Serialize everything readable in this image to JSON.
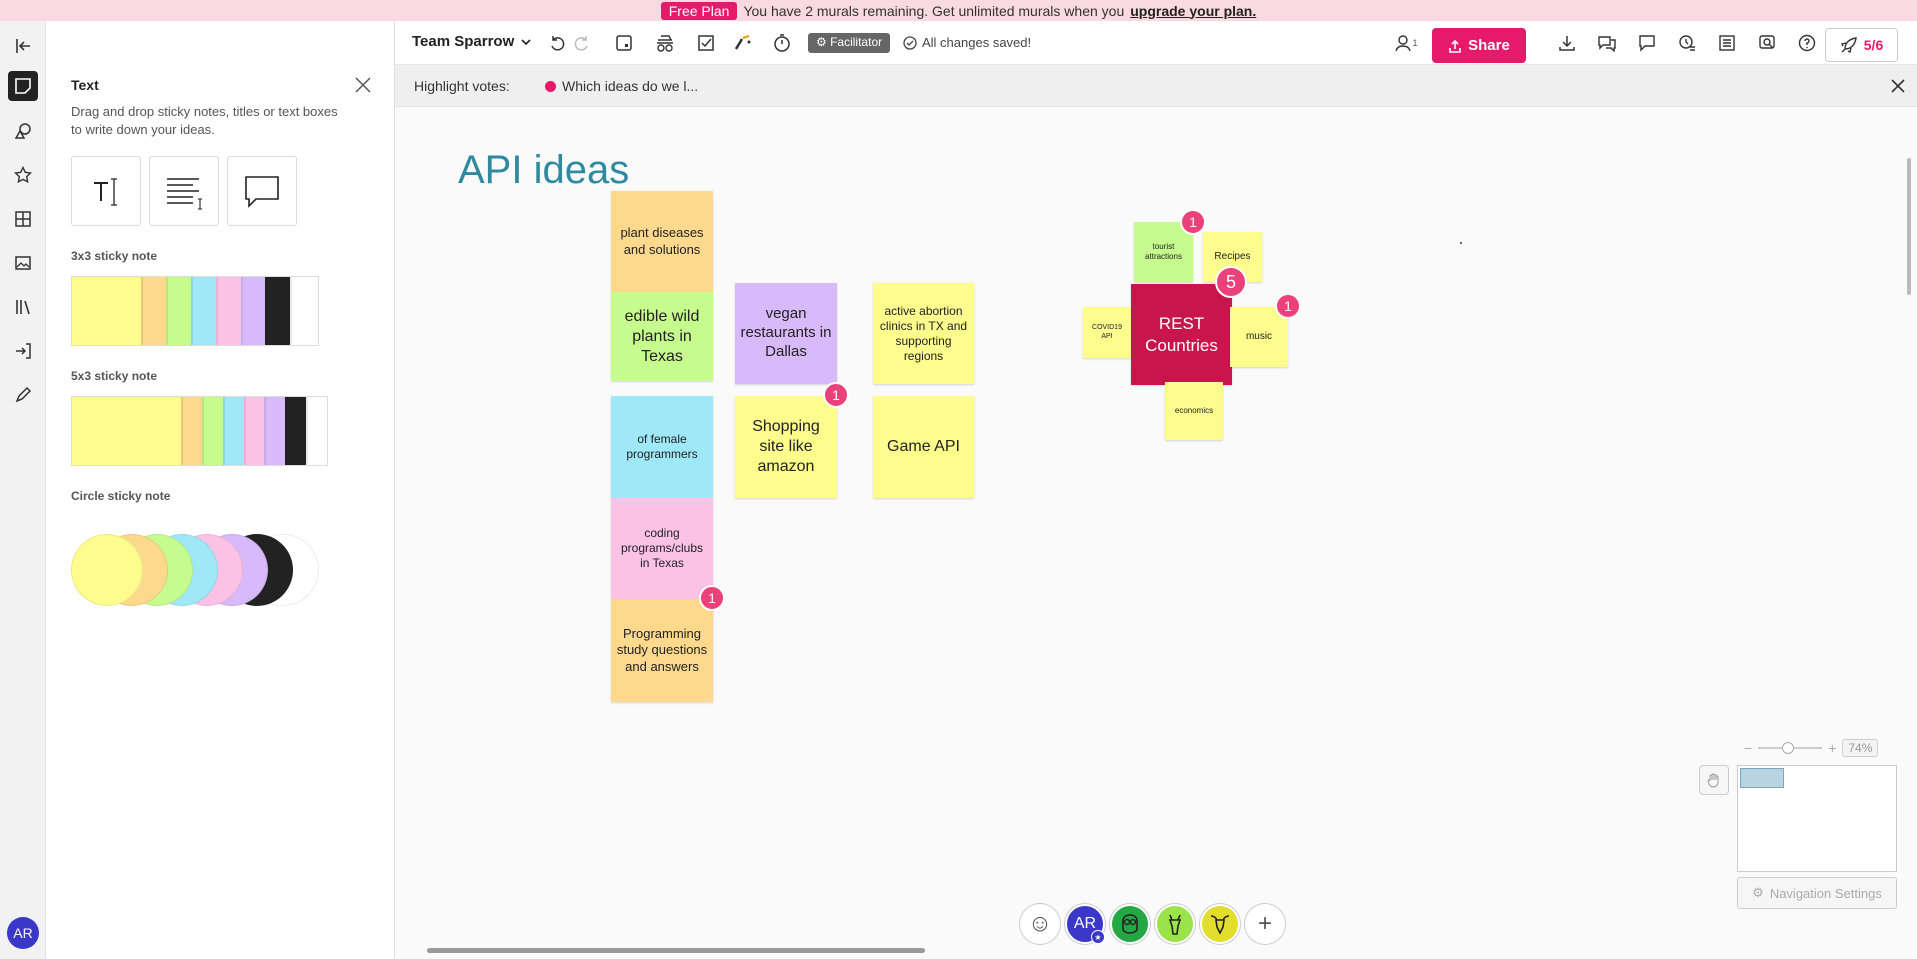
{
  "banner": {
    "plan_label": "Free Plan",
    "message": "You have 2 murals remaining. Get unlimited murals when you",
    "upgrade_link": "upgrade your plan."
  },
  "rail": {
    "icons": [
      "exit-icon",
      "sticky-note-icon",
      "shapes-icon",
      "star-icon",
      "grid-icon",
      "image-icon",
      "library-icon",
      "import-icon",
      "pen-icon"
    ],
    "avatar": "AR"
  },
  "panel": {
    "title": "Text",
    "description": "Drag and drop sticky notes, titles or text boxes to write down your ideas.",
    "sections": {
      "sticky_3x3": "3x3 sticky note",
      "sticky_5x3": "5x3 sticky note",
      "circle": "Circle sticky note"
    },
    "swatch_colors": [
      "#fdfd8e",
      "#fdd98e",
      "#c6fb8e",
      "#9ee8f8",
      "#fbc2e6",
      "#d8b9fa",
      "#222222",
      "#ffffff"
    ]
  },
  "header": {
    "team": "Team Sparrow",
    "facilitator": "Facilitator",
    "saved": "All changes saved!",
    "participants": "1",
    "share": "Share",
    "counter": "5/6"
  },
  "votes": {
    "label": "Highlight votes:",
    "item": "Which ideas do we l..."
  },
  "board": {
    "title": "API ideas",
    "notes": {
      "plant_diseases": "plant diseases and solutions",
      "edible_plants": "edible wild plants in Texas",
      "female_programmers": "of female programmers",
      "coding_programs": "coding programs/clubs in Texas",
      "programming_study": "Programming study questions and answers",
      "vegan": "vegan restaurants in Dallas",
      "shopping": "Shopping site like amazon",
      "abortion": "active abortion clinics in TX and supporting regions",
      "game_api": "Game API",
      "tourist": "tourist attractions",
      "recipes": "Recipes",
      "covid": "COVID19 API",
      "rest_countries": "REST Countries",
      "music": "music",
      "economics": "economics"
    },
    "votes": {
      "programming_study": "1",
      "shopping": "1",
      "tourist": "1",
      "rest_countries": "5",
      "music": "1"
    }
  },
  "zoom": {
    "minus": "−",
    "plus": "+",
    "percent": "74%",
    "level": 0.74
  },
  "navigation_settings": "Navigation Settings",
  "bottom_avatars": [
    {
      "name": "emoji-reactions",
      "label": "☺"
    },
    {
      "name": "AR",
      "label": "AR"
    },
    {
      "name": "anonymous-owl",
      "label": ""
    },
    {
      "name": "anonymous-giraffe",
      "label": ""
    },
    {
      "name": "anonymous-goat",
      "label": ""
    },
    {
      "name": "add",
      "label": "+"
    }
  ]
}
